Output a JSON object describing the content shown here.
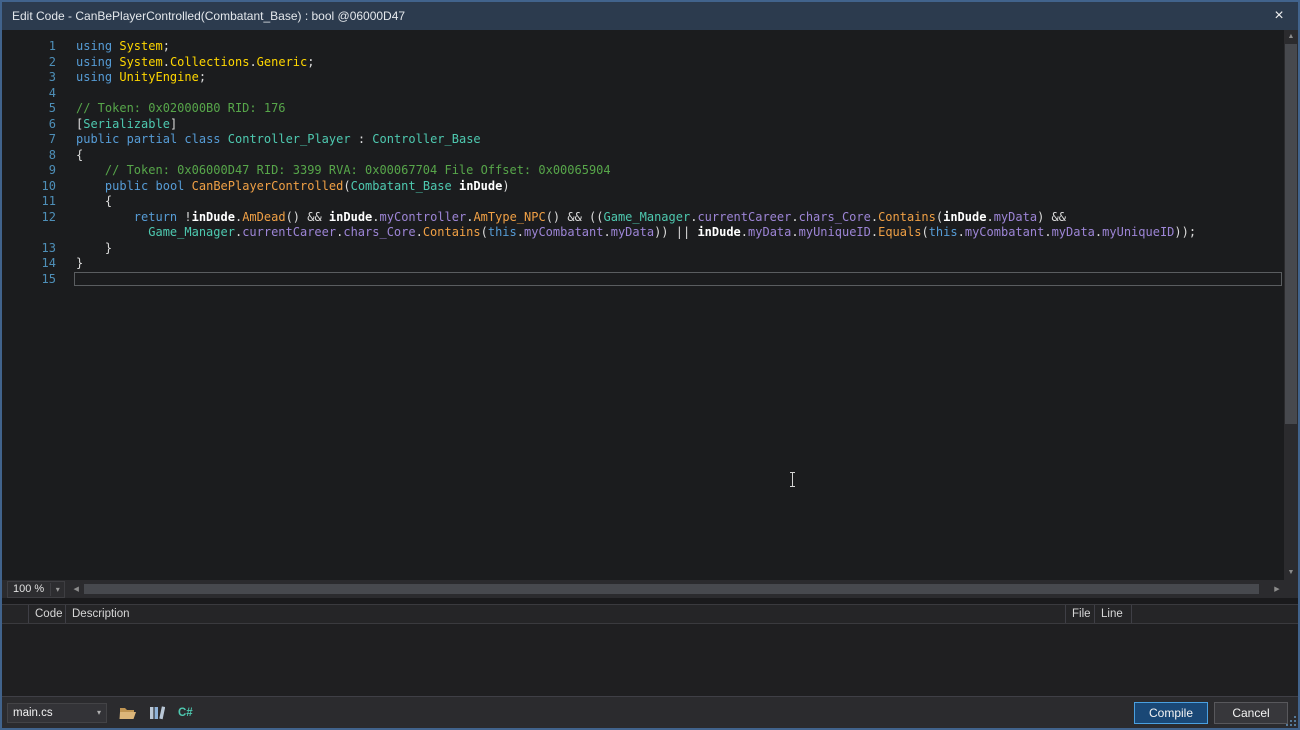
{
  "window": {
    "title": "Edit Code - CanBePlayerControlled(Combatant_Base) : bool @06000D47",
    "close_glyph": "×"
  },
  "scrollbar": {
    "up": "▲",
    "down": "▼",
    "left": "◀",
    "right": "▶",
    "dropdown": "▾"
  },
  "editor": {
    "zoom": "100 %",
    "lines": [
      {
        "num": "1",
        "segments": [
          {
            "t": "using",
            "c": "kw"
          },
          {
            "t": " ",
            "c": "pl"
          },
          {
            "t": "System",
            "c": "ns"
          },
          {
            "t": ";",
            "c": "pl"
          }
        ]
      },
      {
        "num": "2",
        "segments": [
          {
            "t": "using",
            "c": "kw"
          },
          {
            "t": " ",
            "c": "pl"
          },
          {
            "t": "System",
            "c": "ns"
          },
          {
            "t": ".",
            "c": "pl"
          },
          {
            "t": "Collections",
            "c": "ns"
          },
          {
            "t": ".",
            "c": "pl"
          },
          {
            "t": "Generic",
            "c": "ns"
          },
          {
            "t": ";",
            "c": "pl"
          }
        ]
      },
      {
        "num": "3",
        "segments": [
          {
            "t": "using",
            "c": "kw"
          },
          {
            "t": " ",
            "c": "pl"
          },
          {
            "t": "UnityEngine",
            "c": "ns"
          },
          {
            "t": ";",
            "c": "pl"
          }
        ]
      },
      {
        "num": "4",
        "segments": []
      },
      {
        "num": "5",
        "segments": [
          {
            "t": "// Token: 0x020000B0 RID: 176",
            "c": "cm"
          }
        ]
      },
      {
        "num": "6",
        "segments": [
          {
            "t": "[",
            "c": "pl"
          },
          {
            "t": "Serializable",
            "c": "ty"
          },
          {
            "t": "]",
            "c": "pl"
          }
        ]
      },
      {
        "num": "7",
        "segments": [
          {
            "t": "public",
            "c": "kw"
          },
          {
            "t": " ",
            "c": "pl"
          },
          {
            "t": "partial",
            "c": "kw"
          },
          {
            "t": " ",
            "c": "pl"
          },
          {
            "t": "class",
            "c": "kw"
          },
          {
            "t": " ",
            "c": "pl"
          },
          {
            "t": "Controller_Player",
            "c": "ty"
          },
          {
            "t": " : ",
            "c": "pl"
          },
          {
            "t": "Controller_Base",
            "c": "ty"
          }
        ]
      },
      {
        "num": "8",
        "segments": [
          {
            "t": "{",
            "c": "pl"
          }
        ]
      },
      {
        "num": "9",
        "segments": [
          {
            "t": "    ",
            "c": "pl"
          },
          {
            "t": "// Token: 0x06000D47 RID: 3399 RVA: 0x00067704 File Offset: 0x00065904",
            "c": "cm"
          }
        ]
      },
      {
        "num": "10",
        "segments": [
          {
            "t": "    ",
            "c": "pl"
          },
          {
            "t": "public",
            "c": "kw"
          },
          {
            "t": " ",
            "c": "pl"
          },
          {
            "t": "bool",
            "c": "kw"
          },
          {
            "t": " ",
            "c": "pl"
          },
          {
            "t": "CanBePlayerControlled",
            "c": "m"
          },
          {
            "t": "(",
            "c": "pl"
          },
          {
            "t": "Combatant_Base",
            "c": "ty"
          },
          {
            "t": " ",
            "c": "pl"
          },
          {
            "t": "inDude",
            "c": "param"
          },
          {
            "t": ")",
            "c": "pl"
          }
        ]
      },
      {
        "num": "11",
        "segments": [
          {
            "t": "    {",
            "c": "pl"
          }
        ]
      },
      {
        "num": "12",
        "segments": [
          {
            "t": "        ",
            "c": "pl"
          },
          {
            "t": "return",
            "c": "kw"
          },
          {
            "t": " !",
            "c": "pl"
          },
          {
            "t": "inDude",
            "c": "param"
          },
          {
            "t": ".",
            "c": "pl"
          },
          {
            "t": "AmDead",
            "c": "m"
          },
          {
            "t": "() && ",
            "c": "pl"
          },
          {
            "t": "inDude",
            "c": "param"
          },
          {
            "t": ".",
            "c": "pl"
          },
          {
            "t": "myController",
            "c": "fld"
          },
          {
            "t": ".",
            "c": "pl"
          },
          {
            "t": "AmType_NPC",
            "c": "m"
          },
          {
            "t": "() && ((",
            "c": "pl"
          },
          {
            "t": "Game_Manager",
            "c": "ty"
          },
          {
            "t": ".",
            "c": "pl"
          },
          {
            "t": "currentCareer",
            "c": "fld"
          },
          {
            "t": ".",
            "c": "pl"
          },
          {
            "t": "chars_Core",
            "c": "fld"
          },
          {
            "t": ".",
            "c": "pl"
          },
          {
            "t": "Contains",
            "c": "m"
          },
          {
            "t": "(",
            "c": "pl"
          },
          {
            "t": "inDude",
            "c": "param"
          },
          {
            "t": ".",
            "c": "pl"
          },
          {
            "t": "myData",
            "c": "fld"
          },
          {
            "t": ") &&",
            "c": "pl"
          }
        ]
      },
      {
        "num": "",
        "segments": [
          {
            "t": "          ",
            "c": "pl"
          },
          {
            "t": "Game_Manager",
            "c": "ty"
          },
          {
            "t": ".",
            "c": "pl"
          },
          {
            "t": "currentCareer",
            "c": "fld"
          },
          {
            "t": ".",
            "c": "pl"
          },
          {
            "t": "chars_Core",
            "c": "fld"
          },
          {
            "t": ".",
            "c": "pl"
          },
          {
            "t": "Contains",
            "c": "m"
          },
          {
            "t": "(",
            "c": "pl"
          },
          {
            "t": "this",
            "c": "kw"
          },
          {
            "t": ".",
            "c": "pl"
          },
          {
            "t": "myCombatant",
            "c": "fld"
          },
          {
            "t": ".",
            "c": "pl"
          },
          {
            "t": "myData",
            "c": "fld"
          },
          {
            "t": ")) || ",
            "c": "pl"
          },
          {
            "t": "inDude",
            "c": "param"
          },
          {
            "t": ".",
            "c": "pl"
          },
          {
            "t": "myData",
            "c": "fld"
          },
          {
            "t": ".",
            "c": "pl"
          },
          {
            "t": "myUniqueID",
            "c": "fld"
          },
          {
            "t": ".",
            "c": "pl"
          },
          {
            "t": "Equals",
            "c": "m"
          },
          {
            "t": "(",
            "c": "pl"
          },
          {
            "t": "this",
            "c": "kw"
          },
          {
            "t": ".",
            "c": "pl"
          },
          {
            "t": "myCombatant",
            "c": "fld"
          },
          {
            "t": ".",
            "c": "pl"
          },
          {
            "t": "myData",
            "c": "fld"
          },
          {
            "t": ".",
            "c": "pl"
          },
          {
            "t": "myUniqueID",
            "c": "fld"
          },
          {
            "t": "));",
            "c": "pl"
          }
        ]
      },
      {
        "num": "13",
        "segments": [
          {
            "t": "    }",
            "c": "pl"
          }
        ]
      },
      {
        "num": "14",
        "segments": [
          {
            "t": "}",
            "c": "pl"
          }
        ]
      },
      {
        "num": "15",
        "current": true,
        "segments": []
      }
    ]
  },
  "error_list": {
    "columns": [
      "Code",
      "Description",
      "File",
      "Line"
    ],
    "rows": []
  },
  "footer": {
    "file_select": "main.cs",
    "csharp_label": "C#",
    "compile": "Compile",
    "cancel": "Cancel"
  },
  "colors": {
    "window_border": "#41638c",
    "titlebar_bg": "#2c3b4e",
    "editor_bg": "#1b1c1e",
    "primary_button_border": "#4aa0e0",
    "primary_button_bg": "#1a4876",
    "syntax": {
      "kw": "#569cd6",
      "ns": "#ffd700",
      "ty": "#4ec9b0",
      "m": "#f0a045",
      "fld": "#9d85d6",
      "param": "#ffffff",
      "cm": "#57a64a",
      "pl": "#dcdcdc",
      "lineno": "#4e8fb8"
    }
  }
}
